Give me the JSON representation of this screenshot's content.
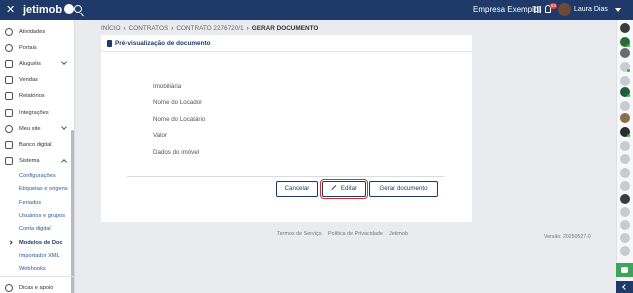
{
  "topbar": {
    "logo_text": "jetimob",
    "company": "Empresa Exemplo",
    "notifications": "84",
    "user": "Laura Dias"
  },
  "sidebar": {
    "items": [
      {
        "label": "Atividades",
        "icon": "check-circle-icon"
      },
      {
        "label": "Portais",
        "icon": "globe-icon"
      },
      {
        "label": "Aluguéis",
        "icon": "book-icon"
      },
      {
        "label": "Vendas",
        "icon": "handshake-icon"
      },
      {
        "label": "Relatórios",
        "icon": "report-icon"
      },
      {
        "label": "Integrações",
        "icon": "puzzle-icon"
      },
      {
        "label": "Meu site",
        "icon": "globe-icon"
      },
      {
        "label": "Banco digital",
        "icon": "piggy-bank-icon"
      },
      {
        "label": "Sistema",
        "icon": "monitor-icon"
      }
    ],
    "sub_items": [
      "Configurações",
      "Etiquetas e origens",
      "Feriados",
      "Usuários e grupos",
      "Conta digital",
      "Modelos de Doc",
      "Importador XML",
      "Webhooks"
    ],
    "help": "Dicas e apoio"
  },
  "breadcrumb": {
    "items": [
      "INÍCIO",
      "CONTRATOS",
      "CONTRATO 2276720/1"
    ],
    "current": "GERAR DOCUMENTO"
  },
  "card": {
    "title": "Pré-visualização de documento",
    "fields": [
      "Imobiliária",
      "Nome do Locador",
      "Nome do Locatário",
      "Valor",
      "Dados do imóvel"
    ]
  },
  "actions": {
    "cancel": "Cancelar",
    "edit": "Editar",
    "generate": "Gerar documento"
  },
  "footer": {
    "links": [
      "Termos de Serviço",
      "Política de Privacidade",
      "Jetimob"
    ],
    "version": "Versão: 20250527-0"
  },
  "colors": {
    "primary": "#1f3a68",
    "highlight": "#d32f2f",
    "chat": "#3da45a",
    "online": "#2cae4b"
  }
}
